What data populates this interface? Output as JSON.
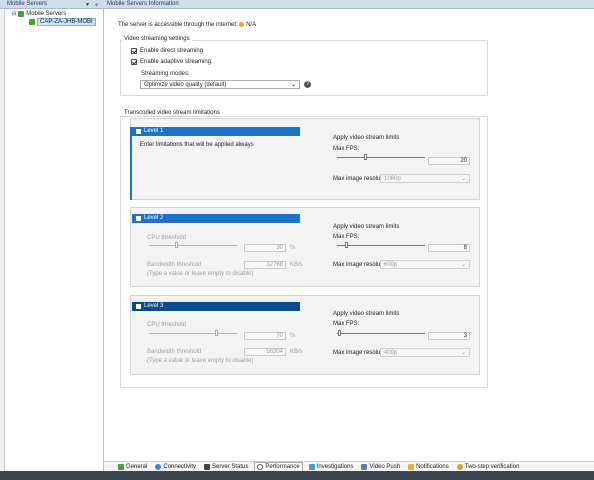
{
  "colors": {
    "accent": "#1c72c4",
    "accent_dark": "#0d4a8c",
    "status_warning": "#f2a51a",
    "header": "#cfdceb"
  },
  "left_pane": {
    "title": "Mobile Servers",
    "tree": [
      {
        "label": "Mobile Servers",
        "icon": "server-group-icon"
      },
      {
        "label": "CAP-ZA-JHB-MOBI",
        "icon": "server-icon",
        "selected": true
      }
    ]
  },
  "right_pane": {
    "title": "Mobile Servers Information",
    "status_text": "The server is accessible through the internet:",
    "status_value": "N/A",
    "video_streaming": {
      "title": "Video streaming settings",
      "enable_direct": "Enable direct streaming",
      "enable_adaptive": "Enable adaptive streaming",
      "modes_label": "Streaming modes:",
      "mode_value": "Optimize video quality (default)"
    },
    "transcoded": {
      "title": "Transcoded video stream limitations",
      "levels": [
        {
          "label": "Level 1",
          "description": "Enter limitations that will be applied always",
          "apply_limits": "Apply video stream limits",
          "max_fps_label": "Max FPS:",
          "max_fps": "20",
          "max_res_label": "Max image resolution:",
          "max_res": "1080p"
        },
        {
          "label": "Level 2",
          "cpu_label": "CPU threshold",
          "cpu_value": "30",
          "cpu_unit": "%",
          "bw_label": "Bandwidth threshold",
          "bw_value": "32768",
          "bw_unit": "KB/s",
          "bw_hint": "(Type a value or leave empty to disable)",
          "apply_limits": "Apply video stream limits",
          "max_fps_label": "Max FPS:",
          "max_fps": "8",
          "max_res_label": "Max image resolution:",
          "max_res": "600p"
        },
        {
          "label": "Level 3",
          "cpu_label": "CPU threshold",
          "cpu_value": "70",
          "cpu_unit": "%",
          "bw_label": "Bandwidth threshold",
          "bw_value": "56304",
          "bw_unit": "KB/s",
          "bw_hint": "(Type a value or leave empty to disable)",
          "apply_limits": "Apply video stream limits",
          "max_fps_label": "Max FPS:",
          "max_fps": "3",
          "max_res_label": "Max image resolution:",
          "max_res": "400p"
        }
      ]
    }
  },
  "tabs": [
    "General",
    "Connectivity",
    "Server Status",
    "Performance",
    "Investigations",
    "Video Push",
    "Notifications",
    "Two-step verification"
  ],
  "active_tab": "Performance"
}
